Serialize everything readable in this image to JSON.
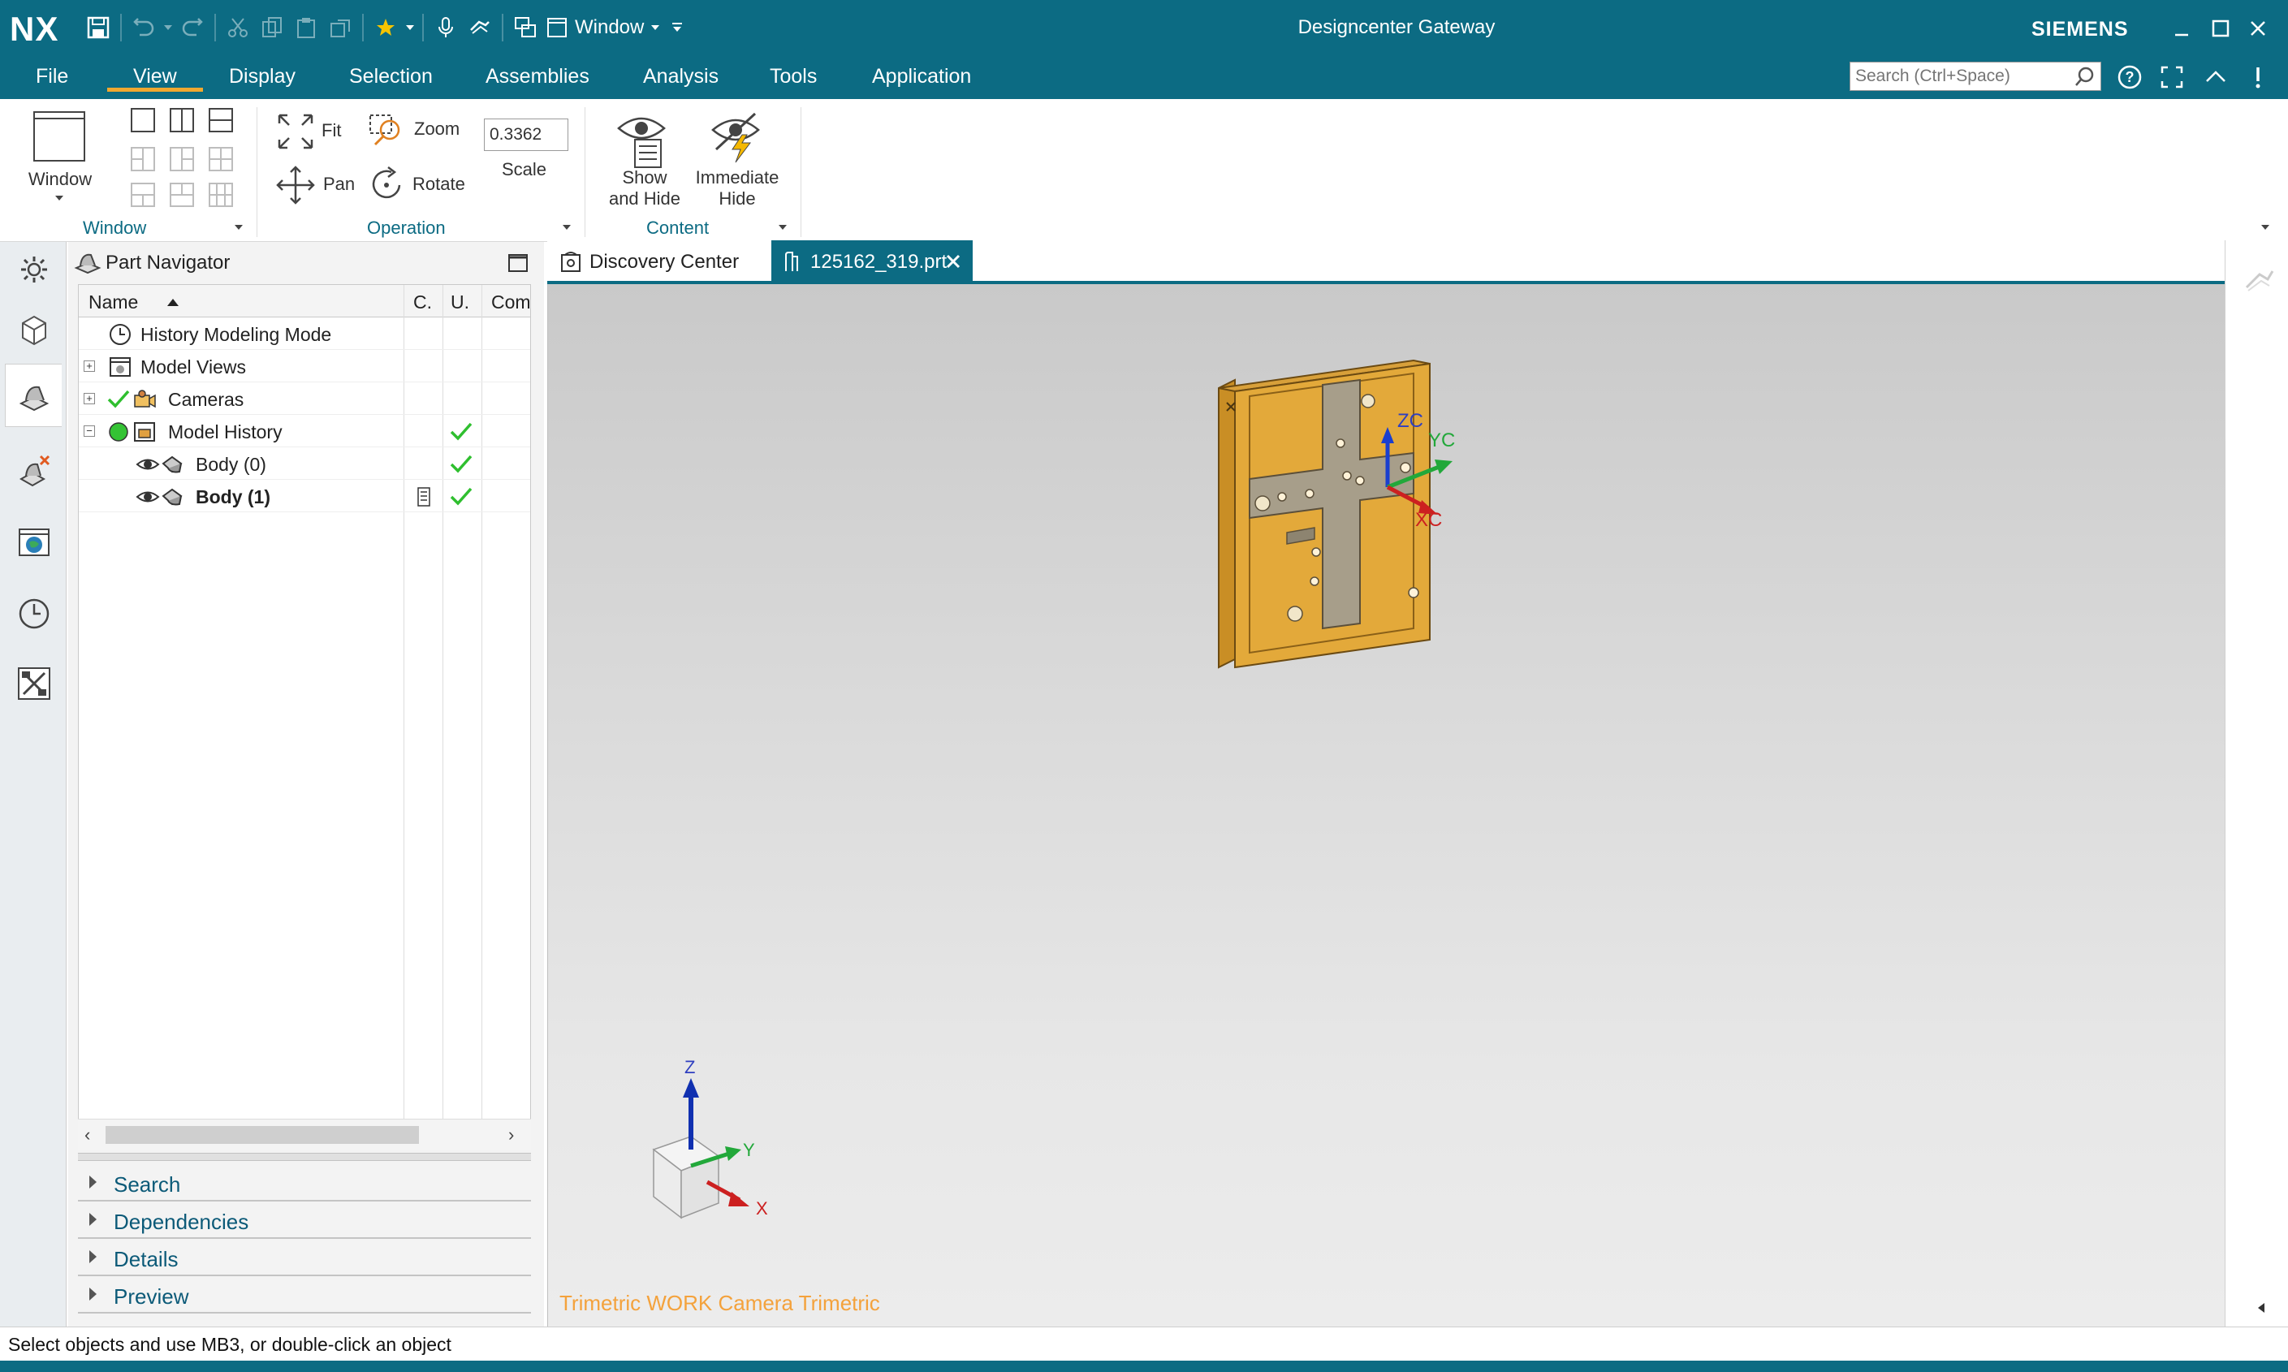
{
  "app": {
    "logo": "NX",
    "title": "Designcenter Gateway",
    "brand": "SIEMENS"
  },
  "quick_access": {
    "window_dropdown_label": "Window"
  },
  "menu": {
    "items": [
      "File",
      "View",
      "Display",
      "Selection",
      "Assemblies",
      "Analysis",
      "Tools",
      "Application"
    ],
    "active": "View",
    "search_placeholder": "Search (Ctrl+Space)"
  },
  "ribbon": {
    "window_group": {
      "window_button_label": "Window",
      "label": "Window"
    },
    "operation_group": {
      "fit": "Fit",
      "zoom": "Zoom",
      "pan": "Pan",
      "rotate": "Rotate",
      "scale_value": "0.3362",
      "scale_label": "Scale",
      "label": "Operation"
    },
    "content_group": {
      "show_and_hide_line1": "Show",
      "show_and_hide_line2": "and Hide",
      "immediate_hide_line1": "Immediate",
      "immediate_hide_line2": "Hide",
      "label": "Content"
    }
  },
  "navigator": {
    "title": "Part Navigator",
    "columns": [
      "Name",
      "C.",
      "U.",
      "Com"
    ],
    "rows": [
      {
        "label": "History Modeling Mode",
        "bold": false
      },
      {
        "label": "Model Views",
        "bold": false
      },
      {
        "label": "Cameras",
        "bold": false
      },
      {
        "label": "Model History",
        "bold": false
      },
      {
        "label": "Body (0)",
        "bold": false
      },
      {
        "label": "Body (1)",
        "bold": true
      }
    ],
    "sections": [
      "Search",
      "Dependencies",
      "Details",
      "Preview"
    ]
  },
  "tabs": [
    {
      "label": "Discovery Center",
      "active": false
    },
    {
      "label": "125162_319.prt",
      "active": true
    }
  ],
  "viewport": {
    "view_label": "Trimetric WORK Camera Trimetric",
    "work_csys": {
      "z": "ZC",
      "y": "YC",
      "x": "XC"
    },
    "view_triad": {
      "z": "Z",
      "y": "Y",
      "x": "X"
    }
  },
  "status": {
    "text": "Select objects and use MB3, or double-click an object"
  },
  "colors": {
    "title_bar": "#0c6b83",
    "accent_underline": "#f0a830",
    "part_color": "#e3a93a",
    "view_label": "#f4a23c",
    "check_green": "#2fbf2f"
  }
}
